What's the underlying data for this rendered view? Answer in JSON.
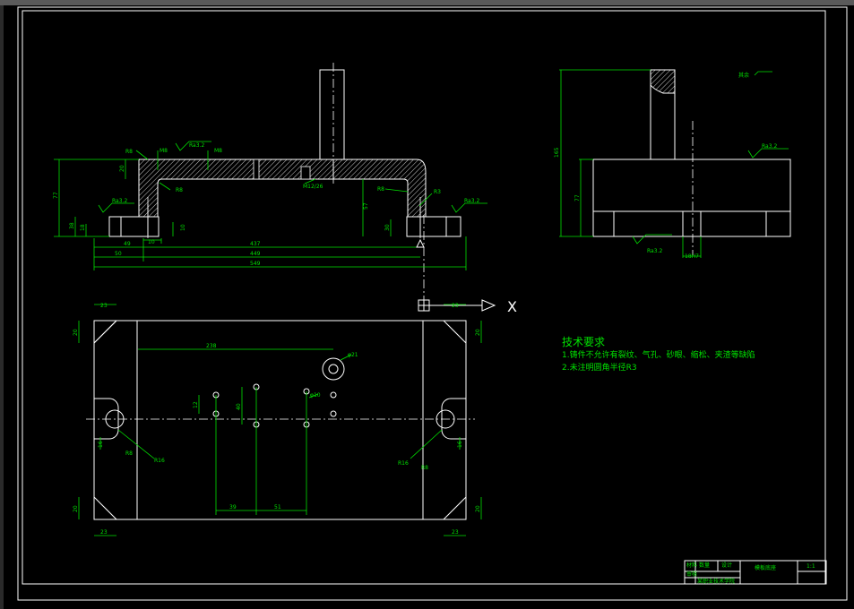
{
  "drawing": {
    "tech_requirements": {
      "title": "技术要求",
      "items": [
        "1.铸件不允许有裂纹、气孔、砂眼、缩松、夹渣等缺陷",
        "2.未注明圆角半径R3"
      ]
    },
    "surface_note": "其余",
    "axis_label": "X",
    "front_view": {
      "roughness": [
        "Ra3.2",
        "Ra3.2",
        "Ra3.2",
        "Ra3.2"
      ],
      "dims": {
        "w437": "437",
        "w449": "449",
        "w549": "549",
        "w49": "49",
        "w50": "50",
        "h77": "77",
        "h38": "38",
        "h57": "57",
        "h30": "30",
        "h18": "18",
        "h10": "10",
        "h20": "20",
        "r8a": "R8",
        "r8b": "R8",
        "r8c": "R8",
        "r3": "R3",
        "m8a": "M8",
        "m8b": "M8",
        "m12": "M12/26",
        "r10": "10"
      }
    },
    "side_view": {
      "roughness": [
        "Ra3.2",
        "Ra3.2"
      ],
      "dims": {
        "h165": "165",
        "h77": "77",
        "w": "18H7"
      }
    },
    "plan_view": {
      "dims": {
        "d238": "238",
        "d21": "φ21",
        "d110": "φ10",
        "d39": "39",
        "d51": "51",
        "d12": "12",
        "d40": "40",
        "r16a": "R16",
        "r16b": "R16",
        "r8a": "R8",
        "r8b": "R8",
        "c23tl": "23",
        "c23tr": "23",
        "c23bl": "23",
        "c23br": "23",
        "c20tl": "20",
        "c20tr": "20",
        "c20bl": "20",
        "c20br": "20",
        "s16l": "16",
        "s16r": "16"
      }
    },
    "title_block": {
      "part_name": "模板底座",
      "scale": "1:1",
      "cells": [
        "材料",
        "数量",
        "设计",
        "审核"
      ],
      "school": "某职业技术学院"
    }
  }
}
